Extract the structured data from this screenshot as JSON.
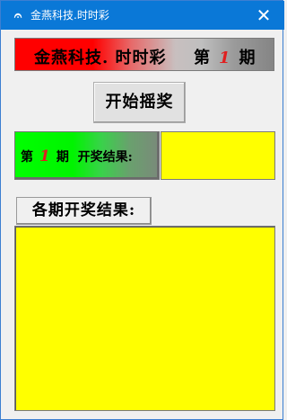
{
  "window": {
    "title": "金燕科技.时时彩",
    "icon": "app-logo-icon",
    "close_glyph": "✕"
  },
  "banner": {
    "title": "金燕科技. 时时彩",
    "period_prefix": "第",
    "period_number": "1",
    "period_suffix": "期"
  },
  "start_button": {
    "label": "开始摇奖"
  },
  "result": {
    "prefix": "第",
    "period_number": "1",
    "suffix": "期",
    "label": "开奖结果:",
    "value": ""
  },
  "history": {
    "label": "各期开奖结果:",
    "items": []
  },
  "colors": {
    "titlebar": "#0a78d7",
    "banner_red": "#ff0000",
    "result_green": "#00ff00",
    "field_yellow": "#ffff00",
    "period_number_red": "#e02020"
  }
}
